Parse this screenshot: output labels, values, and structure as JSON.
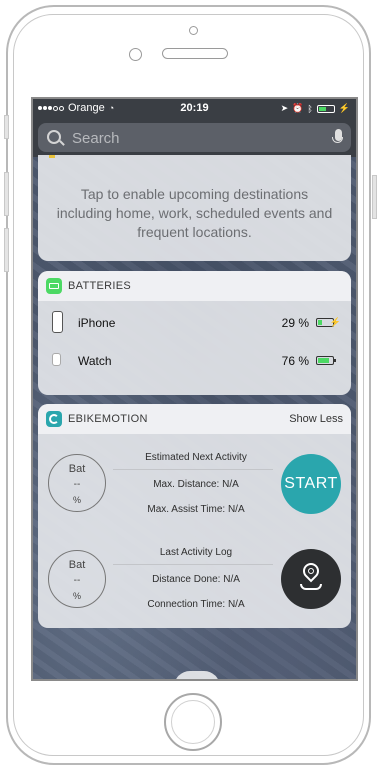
{
  "status_bar": {
    "carrier": "Orange",
    "time": "20:19",
    "colors": {
      "battery": "#4cd964"
    }
  },
  "search": {
    "placeholder": "Search"
  },
  "destinations_widget": {
    "text": "Tap to enable upcoming destinations including home, work, scheduled events and frequent locations."
  },
  "batteries_widget": {
    "title": "BATTERIES",
    "icon": "battery-widget-icon",
    "color": "#4cd964",
    "devices": [
      {
        "name": "iPhone",
        "percent": "29 %",
        "level": 0.29,
        "charging": true
      },
      {
        "name": "Watch",
        "percent": "76 %",
        "level": 0.76,
        "charging": false
      }
    ]
  },
  "ebike_widget": {
    "title": "EBIKEMOTION",
    "show_less": "Show Less",
    "icon_color": "#2aa6ad",
    "next_activity": {
      "ring": {
        "label": "Bat",
        "value": "--",
        "unit": "%"
      },
      "heading": "Estimated Next Activity",
      "line1": "Max. Distance: N/A",
      "line2": "Max. Assist Time: N/A",
      "button": "START"
    },
    "last_activity": {
      "ring": {
        "label": "Bat",
        "value": "--",
        "unit": "%"
      },
      "heading": "Last Activity Log",
      "line1": "Distance Done: N/A",
      "line2": "Connection Time: N/A"
    }
  }
}
